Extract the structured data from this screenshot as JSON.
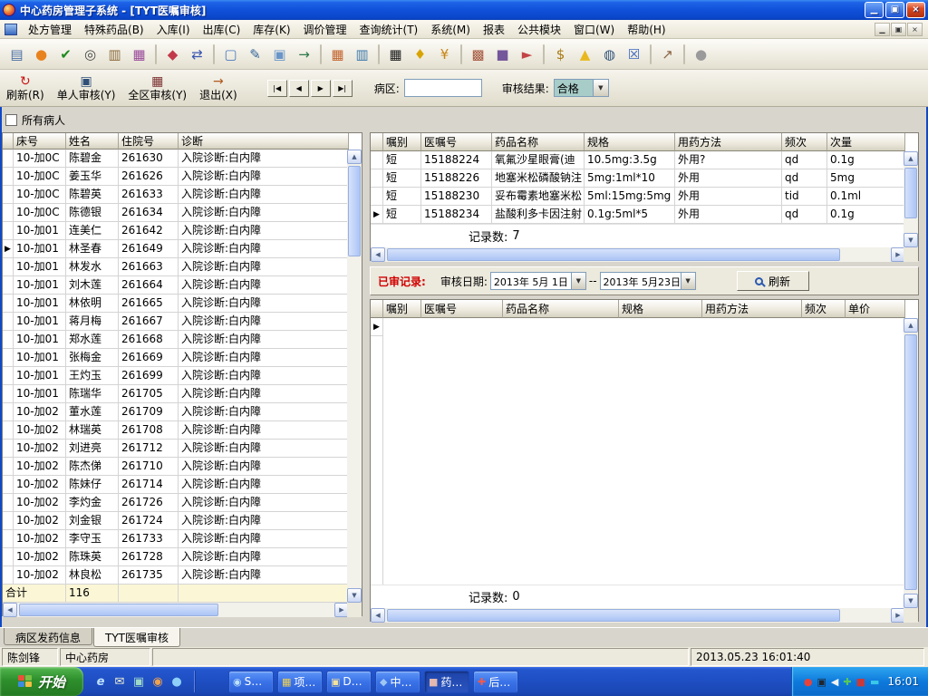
{
  "window": {
    "title": "中心药房管理子系统 - [TYT医嘱审核]",
    "controls": {
      "minimize": "▁",
      "restore": "▣",
      "close": "×"
    }
  },
  "ui": {
    "dropdown": "▼",
    "up": "▲",
    "down": "▼",
    "left": "◀",
    "right": "▶"
  },
  "menu": {
    "items": [
      "处方管理",
      "特殊药品(B)",
      "入库(I)",
      "出库(C)",
      "库存(K)",
      "调价管理",
      "查询统计(T)",
      "系统(M)",
      "报表",
      "公共模块",
      "窗口(W)",
      "帮助(H)"
    ]
  },
  "toolbar": {
    "icons": [
      {
        "name": "preview-icon",
        "glyph": "▤",
        "color": "#4A6FA5"
      },
      {
        "name": "info-icon",
        "glyph": "●",
        "color": "#E8821E"
      },
      {
        "name": "approve-icon",
        "glyph": "✔",
        "color": "#1F8A1F"
      },
      {
        "name": "binoculars-icon",
        "glyph": "◎",
        "color": "#444444"
      },
      {
        "name": "ledger-icon",
        "glyph": "▥",
        "color": "#8A6A3A"
      },
      {
        "name": "stats-icon",
        "glyph": "▦",
        "color": "#9A4A9A"
      },
      {
        "sep": true
      },
      {
        "name": "audit-icon",
        "glyph": "◆",
        "color": "#C23A4A"
      },
      {
        "name": "transfer-icon",
        "glyph": "⇄",
        "color": "#3A55B0"
      },
      {
        "sep": true
      },
      {
        "name": "new-doc-icon",
        "glyph": "▢",
        "color": "#4A7AC0"
      },
      {
        "name": "edit-check-icon",
        "glyph": "✎",
        "color": "#33669A"
      },
      {
        "name": "copy-doc-icon",
        "glyph": "▣",
        "color": "#6A95C8"
      },
      {
        "name": "send-doc-icon",
        "glyph": "→",
        "color": "#2E7A4A"
      },
      {
        "sep": true
      },
      {
        "name": "calendar-icon",
        "glyph": "▦",
        "color": "#C2652E"
      },
      {
        "name": "table-icon",
        "glyph": "▥",
        "color": "#3A77AA"
      },
      {
        "sep": true
      },
      {
        "name": "barcode-icon",
        "glyph": "▦",
        "color": "#1A1A1A"
      },
      {
        "name": "bell-icon",
        "glyph": "♦",
        "color": "#D8A400"
      },
      {
        "name": "coins-icon",
        "glyph": "¥",
        "color": "#C88414"
      },
      {
        "sep": true
      },
      {
        "name": "parcel-icon",
        "glyph": "▩",
        "color": "#A4543A"
      },
      {
        "name": "box-icon",
        "glyph": "■",
        "color": "#74569A"
      },
      {
        "name": "tools-icon",
        "glyph": "►",
        "color": "#C24444"
      },
      {
        "sep": true
      },
      {
        "name": "moneybag-icon",
        "glyph": "$",
        "color": "#A87A14"
      },
      {
        "name": "torch-icon",
        "glyph": "▲",
        "color": "#E8B81E"
      },
      {
        "name": "search-icon",
        "glyph": "◍",
        "color": "#33557A"
      },
      {
        "name": "close-box-icon",
        "glyph": "☒",
        "color": "#3A66C2"
      },
      {
        "sep": true
      },
      {
        "name": "export-icon",
        "glyph": "↗",
        "color": "#8A6444"
      },
      {
        "sep": true
      },
      {
        "name": "sphere-icon",
        "glyph": "●",
        "color": "#9A9A9A"
      }
    ]
  },
  "actionbar": {
    "buttons": [
      {
        "name": "refresh-button",
        "label": "刷新(R)",
        "glyph": "↻",
        "color": "#C81414"
      },
      {
        "name": "single-audit-button",
        "label": "单人审核(Y)",
        "glyph": "▣",
        "color": "#2F4F78"
      },
      {
        "name": "area-audit-button",
        "label": "全区审核(Y)",
        "glyph": "▦",
        "color": "#7A2F2F"
      },
      {
        "name": "exit-button",
        "label": "退出(X)",
        "glyph": "→",
        "color": "#B05A1E"
      }
    ],
    "nav": [
      "|◀",
      "◀",
      "▶",
      "▶|"
    ],
    "ward_label": "病区:",
    "ward_value": "",
    "result_label": "审核结果:",
    "result_value": "合格"
  },
  "filters": {
    "all_patients_label": "所有病人",
    "all_patients_checked": false
  },
  "patient_table": {
    "columns": [
      "床号",
      "姓名",
      "住院号",
      "诊断"
    ],
    "rows": [
      [
        "",
        "10-加0C",
        "陈碧金",
        "261630",
        "入院诊断:白内障"
      ],
      [
        "",
        "10-加0C",
        "姜玉华",
        "261626",
        "入院诊断:白内障"
      ],
      [
        "",
        "10-加0C",
        "陈碧英",
        "261633",
        "入院诊断:白内障"
      ],
      [
        "",
        "10-加0C",
        "陈德银",
        "261634",
        "入院诊断:白内障"
      ],
      [
        "",
        "10-加01",
        "连美仁",
        "261642",
        "入院诊断:白内障"
      ],
      [
        "▶",
        "10-加01",
        "林圣春",
        "261649",
        "入院诊断:白内障"
      ],
      [
        "",
        "10-加01",
        "林发水",
        "261663",
        "入院诊断:白内障"
      ],
      [
        "",
        "10-加01",
        "刘木莲",
        "261664",
        "入院诊断:白内障"
      ],
      [
        "",
        "10-加01",
        "林依明",
        "261665",
        "入院诊断:白内障"
      ],
      [
        "",
        "10-加01",
        "蒋月梅",
        "261667",
        "入院诊断:白内障"
      ],
      [
        "",
        "10-加01",
        "郑水莲",
        "261668",
        "入院诊断:白内障"
      ],
      [
        "",
        "10-加01",
        "张梅金",
        "261669",
        "入院诊断:白内障"
      ],
      [
        "",
        "10-加01",
        "王灼玉",
        "261699",
        "入院诊断:白内障"
      ],
      [
        "",
        "10-加01",
        "陈瑞华",
        "261705",
        "入院诊断:白内障"
      ],
      [
        "",
        "10-加02",
        "董水莲",
        "261709",
        "入院诊断:白内障"
      ],
      [
        "",
        "10-加02",
        "林瑞英",
        "261708",
        "入院诊断:白内障"
      ],
      [
        "",
        "10-加02",
        "刘进亮",
        "261712",
        "入院诊断:白内障"
      ],
      [
        "",
        "10-加02",
        "陈杰俤",
        "261710",
        "入院诊断:白内障"
      ],
      [
        "",
        "10-加02",
        "陈妹仔",
        "261714",
        "入院诊断:白内障"
      ],
      [
        "",
        "10-加02",
        "李灼金",
        "261726",
        "入院诊断:白内障"
      ],
      [
        "",
        "10-加02",
        "刘金银",
        "261724",
        "入院诊断:白内障"
      ],
      [
        "",
        "10-加02",
        "李守玉",
        "261733",
        "入院诊断:白内障"
      ],
      [
        "",
        "10-加02",
        "陈珠英",
        "261728",
        "入院诊断:白内障"
      ],
      [
        "",
        "10-加02",
        "林良松",
        "261735",
        "入院诊断:白内障"
      ]
    ],
    "total_row": {
      "label": "合计",
      "value": "116"
    }
  },
  "orders_table": {
    "columns": [
      "嘱别",
      "医嘱号",
      "药品名称",
      "规格",
      "用药方法",
      "频次",
      "次量"
    ],
    "rows": [
      [
        "",
        "短",
        "15188224",
        "氧氟沙星眼膏(迪",
        "10.5mg:3.5g",
        "外用?",
        "qd",
        "0.1g"
      ],
      [
        "",
        "短",
        "15188226",
        "地塞米松磷酸钠注",
        "5mg:1ml*10",
        "外用",
        "qd",
        "5mg"
      ],
      [
        "",
        "短",
        "15188230",
        "妥布霉素地塞米松",
        "5ml:15mg:5mg",
        "外用",
        "tid",
        "0.1ml"
      ],
      [
        "▶",
        "短",
        "15188234",
        "盐酸利多卡因注射",
        "0.1g:5ml*5",
        "外用",
        "qd",
        "0.1g"
      ]
    ],
    "record_count_label": "记录数:",
    "record_count": "7"
  },
  "reviewed": {
    "title": "已审记录:",
    "date_label": "审核日期:",
    "date_from": "2013年 5月 1日",
    "separator": "--",
    "date_to": "2013年 5月23日",
    "refresh_label": "刷新"
  },
  "reviewed_table": {
    "columns": [
      "嘱别",
      "医嘱号",
      "药品名称",
      "规格",
      "用药方法",
      "频次",
      "单价"
    ],
    "record_count_label": "记录数:",
    "record_count": "0"
  },
  "tabs": [
    {
      "name": "tab-ward-dispense",
      "label": "病区发药信息",
      "active": false
    },
    {
      "name": "tab-tyt-audit",
      "label": "TYT医嘱审核",
      "active": true
    }
  ],
  "statusbar": {
    "user": "陈剑锋",
    "department": "中心药房",
    "middle": "",
    "timestamp": "2013.05.23 16:01:40"
  },
  "taskbar": {
    "start_label": "开始",
    "quick_launch": [
      {
        "name": "ie-icon",
        "glyph": "e",
        "color": "#BDE0FF"
      },
      {
        "name": "mail-icon",
        "glyph": "✉",
        "color": "#F2F2D0"
      },
      {
        "name": "desktop-icon",
        "glyph": "▣",
        "color": "#9ED8C8"
      },
      {
        "name": "player-icon",
        "glyph": "◉",
        "color": "#F0A24E"
      },
      {
        "name": "qq-icon",
        "glyph": "●",
        "color": "#8ED0F8"
      }
    ],
    "tasks": [
      {
        "name": "task-s",
        "label": "S…",
        "glyph": "◉",
        "color": "#BDE2FA"
      },
      {
        "name": "task-xiang",
        "label": "项…",
        "glyph": "▦",
        "color": "#F2D24E"
      },
      {
        "name": "task-d",
        "label": "D…",
        "glyph": "▣",
        "color": "#F2E29E"
      },
      {
        "name": "task-zhong",
        "label": "中…",
        "glyph": "◆",
        "color": "#9EC6F2"
      },
      {
        "name": "task-yao",
        "label": "药…",
        "glyph": "■",
        "color": "#E2B8B0",
        "pressed": true
      },
      {
        "name": "task-hou",
        "label": "后…",
        "glyph": "✚",
        "color": "#F25A4E"
      }
    ],
    "tray_icons": [
      {
        "name": "alarm-icon",
        "glyph": "●",
        "color": "#E8433A"
      },
      {
        "name": "monitor-icon",
        "glyph": "▣",
        "color": "#20262E"
      },
      {
        "name": "volume-icon",
        "glyph": "◀",
        "color": "#F2F2F2"
      },
      {
        "name": "shield-icon",
        "glyph": "✚",
        "color": "#58C858"
      },
      {
        "name": "stop-icon",
        "glyph": "■",
        "color": "#C83A3A"
      },
      {
        "name": "network-icon",
        "glyph": "▬",
        "color": "#3AC8E8"
      }
    ],
    "clock": "16:01"
  }
}
